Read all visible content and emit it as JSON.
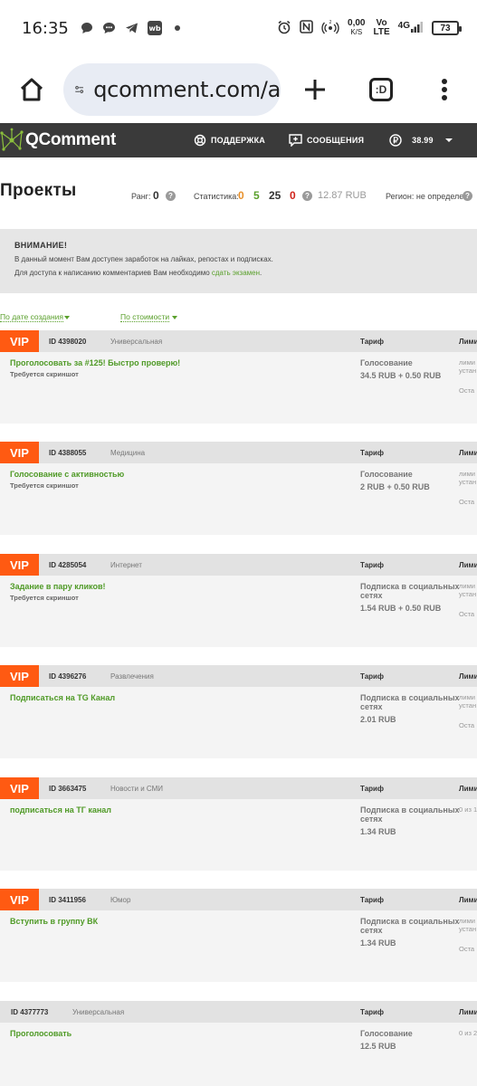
{
  "status_bar": {
    "time": "16:35",
    "net_speed_value": "0,00",
    "net_speed_unit": "K/S",
    "volte_top": "Vo",
    "volte_bottom": "LTE",
    "network": "4G",
    "battery": "73",
    "icons": [
      "chat-bubble-icon",
      "messages-icon",
      "telegram-icon",
      "wb-icon",
      "dot-icon",
      "alarm-icon",
      "nfc-icon",
      "hotspot-icon",
      "signal-icon"
    ]
  },
  "browser": {
    "url": "qcomment.com/a",
    "tabs_label": ":D"
  },
  "site_header": {
    "logo": "QComment",
    "support": "ПОДДЕРЖКА",
    "messages": "СООБЩЕНИЯ",
    "balance": "38.99"
  },
  "page": {
    "title": "Проекты",
    "rank_label": "Ранг:",
    "rank_value": "0",
    "stats_label": "Статистика:",
    "stats": [
      {
        "value": "0",
        "color": "#e8902a"
      },
      {
        "value": "5",
        "color": "#5aa02c"
      },
      {
        "value": "25",
        "color": "#333333"
      },
      {
        "value": "0",
        "color": "#d0241c"
      }
    ],
    "stats_money": "12.87 RUB",
    "region": "Регион: не определен"
  },
  "notice": {
    "title": "ВНИМАНИЕ!",
    "line1": "В данный момент Вам доступен заработок на лайках, репостах и подписках.",
    "line2_prefix": "Для доступа к написанию комментариев Вам необходимо",
    "line2_link": "сдать экзамен",
    "line2_suffix": "."
  },
  "sort": {
    "by_date": "По дате создания",
    "by_price": "По стоимости"
  },
  "labels": {
    "vip": "VIP",
    "tariff": "Тариф",
    "limit": "Лими"
  },
  "tasks": [
    {
      "vip": true,
      "id": "ID 4398020",
      "category": "Универсальная",
      "title": "Проголосовать за #125! Быстро проверю!",
      "requirement": "Требуется скриншот",
      "tariff": "Голосование",
      "price": "34.5 RUB + 0.50 RUB",
      "limit_line1": "лими",
      "limit_line2": "устан",
      "remaining": "Оста"
    },
    {
      "vip": true,
      "id": "ID 4388055",
      "category": "Медицина",
      "title": "Голосование с активностью",
      "requirement": "Требуется скриншот",
      "tariff": "Голосование",
      "price": "2 RUB + 0.50 RUB",
      "limit_line1": "лими",
      "limit_line2": "устан",
      "remaining": "Оста"
    },
    {
      "vip": true,
      "id": "ID 4285054",
      "category": "Интернет",
      "title": "Задание в пару кликов!",
      "requirement": "Требуется скриншот",
      "tariff": "Подписка в социальных сетях",
      "price": "1.54 RUB + 0.50 RUB",
      "limit_line1": "лими",
      "limit_line2": "устан",
      "remaining": "Оста"
    },
    {
      "vip": true,
      "id": "ID 4396276",
      "category": "Развлечения",
      "title": "Подписаться на TG Канал",
      "requirement": "",
      "tariff": "Подписка в социальных сетях",
      "price": "2.01 RUB",
      "limit_line1": "лими",
      "limit_line2": "устан",
      "remaining": "Оста"
    },
    {
      "vip": true,
      "id": "ID 3663475",
      "category": "Новости и СМИ",
      "title": "подписаться на ТГ канал",
      "requirement": "",
      "tariff": "Подписка в социальных сетях",
      "price": "1.34 RUB",
      "limit_line1": "0 из 1",
      "limit_line2": "",
      "remaining": ""
    },
    {
      "vip": true,
      "id": "ID 3411956",
      "category": "Юмор",
      "title": "Вступить в группу ВК",
      "requirement": "",
      "tariff": "Подписка в социальных сетях",
      "price": "1.34 RUB",
      "limit_line1": "лими",
      "limit_line2": "устан",
      "remaining": "Оста"
    },
    {
      "vip": false,
      "id": "ID 4377773",
      "category": "Универсальная",
      "title": "Проголосовать",
      "requirement": "",
      "tariff": "Голосование",
      "price": "12.5 RUB",
      "limit_line1": "0 из 2",
      "limit_line2": "",
      "remaining": ""
    }
  ]
}
